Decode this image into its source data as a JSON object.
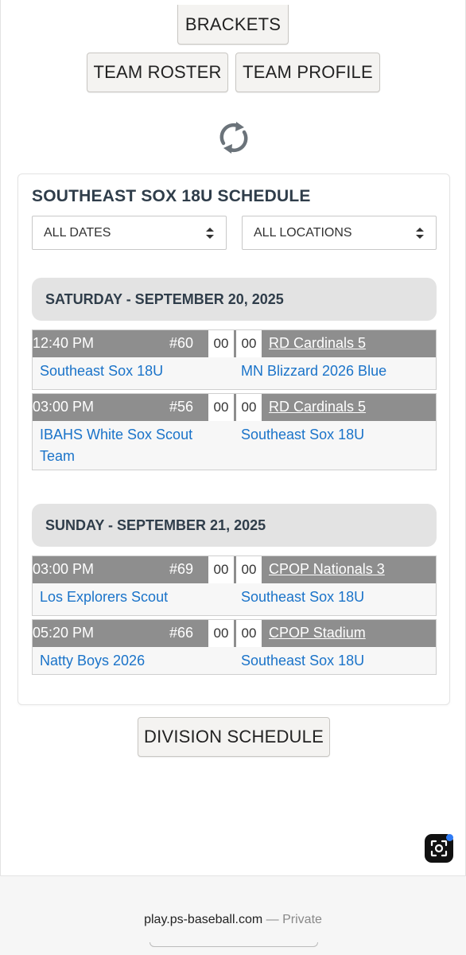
{
  "nav": {
    "brackets_label": "BRACKETS",
    "roster_label": "TEAM ROSTER",
    "profile_label": "TEAM PROFILE"
  },
  "schedule": {
    "title": "SOUTHEAST SOX 18U SCHEDULE",
    "filters": {
      "dates_selected": "ALL DATES",
      "locations_selected": "ALL LOCATIONS"
    },
    "days": [
      {
        "header": "SATURDAY - SEPTEMBER 20, 2025",
        "games": [
          {
            "time": "12:40 PM",
            "number": "#60",
            "score_a": "00",
            "score_b": "00",
            "location": "RD Cardinals 5",
            "team_a": "Southeast Sox 18U",
            "team_b": "MN Blizzard 2026 Blue"
          },
          {
            "time": "03:00 PM",
            "number": "#56",
            "score_a": "00",
            "score_b": "00",
            "location": "RD Cardinals 5",
            "team_a": "IBAHS White Sox Scout Team",
            "team_b": "Southeast Sox 18U"
          }
        ]
      },
      {
        "header": "SUNDAY - SEPTEMBER 21, 2025",
        "games": [
          {
            "time": "03:00 PM",
            "number": "#69",
            "score_a": "00",
            "score_b": "00",
            "location": "CPOP Nationals 3",
            "team_a": "Los Explorers Scout",
            "team_b": "Southeast Sox 18U"
          },
          {
            "time": "05:20 PM",
            "number": "#66",
            "score_a": "00",
            "score_b": "00",
            "location": "CPOP Stadium",
            "team_a": "Natty Boys 2026",
            "team_b": "Southeast Sox 18U"
          }
        ]
      }
    ]
  },
  "division_label": "DIVISION SCHEDULE",
  "browser": {
    "url": "play.ps-baseball.com",
    "separator": "—",
    "privacy": "Private"
  },
  "icons": {
    "refresh": "refresh-icon",
    "select_arrows": "updown-arrows-icon",
    "screenshot": "screenshot-tool-icon"
  },
  "colors": {
    "game_header_bg": "#8e8e8e",
    "team_link": "#1a73c9",
    "day_header_bg": "#e3e3e3",
    "title_text": "#2f3d4a"
  }
}
